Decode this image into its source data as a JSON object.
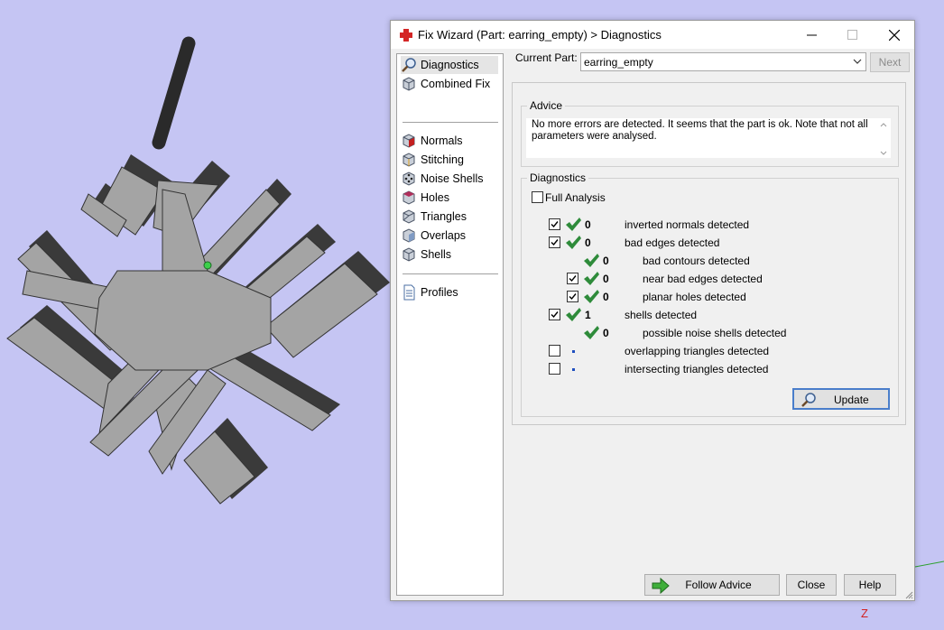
{
  "window": {
    "title": "Fix Wizard (Part: earring_empty) > Diagnostics"
  },
  "sidebar": {
    "items": [
      {
        "label": "Diagnostics",
        "icon": "magnifier-icon"
      },
      {
        "label": "Combined Fix",
        "icon": "cube-icon"
      },
      {
        "label": "Normals",
        "icon": "cube-red-face-icon"
      },
      {
        "label": "Stitching",
        "icon": "cube-icon"
      },
      {
        "label": "Noise Shells",
        "icon": "dice-icon"
      },
      {
        "label": "Holes",
        "icon": "cube-icon"
      },
      {
        "label": "Triangles",
        "icon": "cube-icon"
      },
      {
        "label": "Overlaps",
        "icon": "cube-icon"
      },
      {
        "label": "Shells",
        "icon": "cube-icon"
      },
      {
        "label": "Profiles",
        "icon": "document-icon"
      }
    ]
  },
  "current_part": {
    "label": "Current Part:",
    "value": "earring_empty",
    "next_label": "Next"
  },
  "advice": {
    "title": "Advice",
    "text": "No more errors are detected. It seems that the part is ok. Note that not all parameters were analysed."
  },
  "diagnostics": {
    "title": "Diagnostics",
    "full_analysis_label": "Full Analysis",
    "rows": [
      {
        "count": "0",
        "label": "inverted normals detected"
      },
      {
        "count": "0",
        "label": "bad edges detected"
      },
      {
        "count": "0",
        "label": "bad contours detected"
      },
      {
        "count": "0",
        "label": "near bad edges detected"
      },
      {
        "count": "0",
        "label": "planar holes detected"
      },
      {
        "count": "1",
        "label": "shells detected"
      },
      {
        "count": "0",
        "label": "possible noise shells detected"
      },
      {
        "count": "",
        "label": "overlapping triangles detected"
      },
      {
        "count": "",
        "label": "intersecting triangles detected"
      }
    ],
    "update_label": "Update"
  },
  "footer": {
    "follow_advice_label": "Follow Advice",
    "close_label": "Close",
    "help_label": "Help"
  },
  "viewport": {
    "axis_label": "Z"
  },
  "colors": {
    "viewport_bg": "#c5c5f3",
    "part_gray": "#a4a4a4",
    "check_green": "#2e8b3a",
    "accent_blue": "#4a7ecb"
  }
}
